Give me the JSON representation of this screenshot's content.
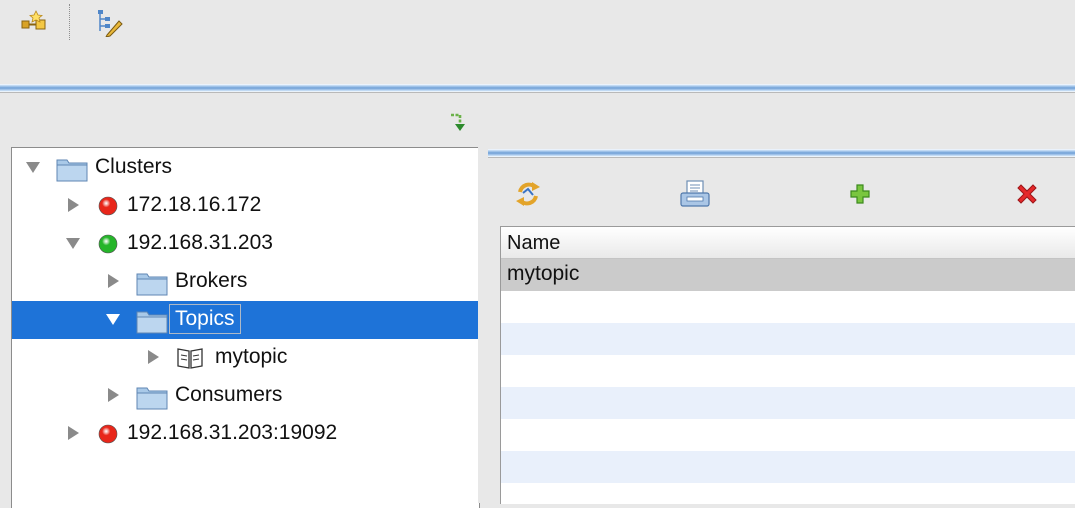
{
  "tree": {
    "nodes": [
      {
        "id": "clusters",
        "label": "Clusters",
        "level": 0,
        "expanded": true,
        "icon": "folder-icon",
        "status": null,
        "selected": false
      },
      {
        "id": "c1",
        "label": "172.18.16.172",
        "level": 1,
        "expanded": false,
        "icon": "status-dot-icon",
        "status": "#e8261a",
        "selected": false
      },
      {
        "id": "c2",
        "label": "192.168.31.203",
        "level": 1,
        "expanded": true,
        "icon": "status-dot-icon",
        "status": "#25b52a",
        "selected": false
      },
      {
        "id": "brokers",
        "label": "Brokers",
        "level": 2,
        "expanded": false,
        "icon": "folder-icon",
        "status": null,
        "selected": false
      },
      {
        "id": "topics",
        "label": "Topics",
        "level": 2,
        "expanded": true,
        "icon": "folder-icon",
        "status": null,
        "selected": true
      },
      {
        "id": "mytopic",
        "label": "mytopic",
        "level": 3,
        "expanded": false,
        "icon": "book-icon",
        "status": null,
        "selected": false
      },
      {
        "id": "consumers",
        "label": "Consumers",
        "level": 2,
        "expanded": false,
        "icon": "folder-icon",
        "status": null,
        "selected": false
      },
      {
        "id": "c3",
        "label": "192.168.31.203:19092",
        "level": 1,
        "expanded": false,
        "icon": "status-dot-icon",
        "status": "#e8261a",
        "selected": false
      }
    ]
  },
  "table": {
    "columns": [
      "Name"
    ],
    "rows": [
      [
        "mytopic"
      ]
    ]
  },
  "colors": {
    "selection": "#1e73d8",
    "stripe": "#e9f0fb",
    "selected_row": "#cbcbcb"
  }
}
